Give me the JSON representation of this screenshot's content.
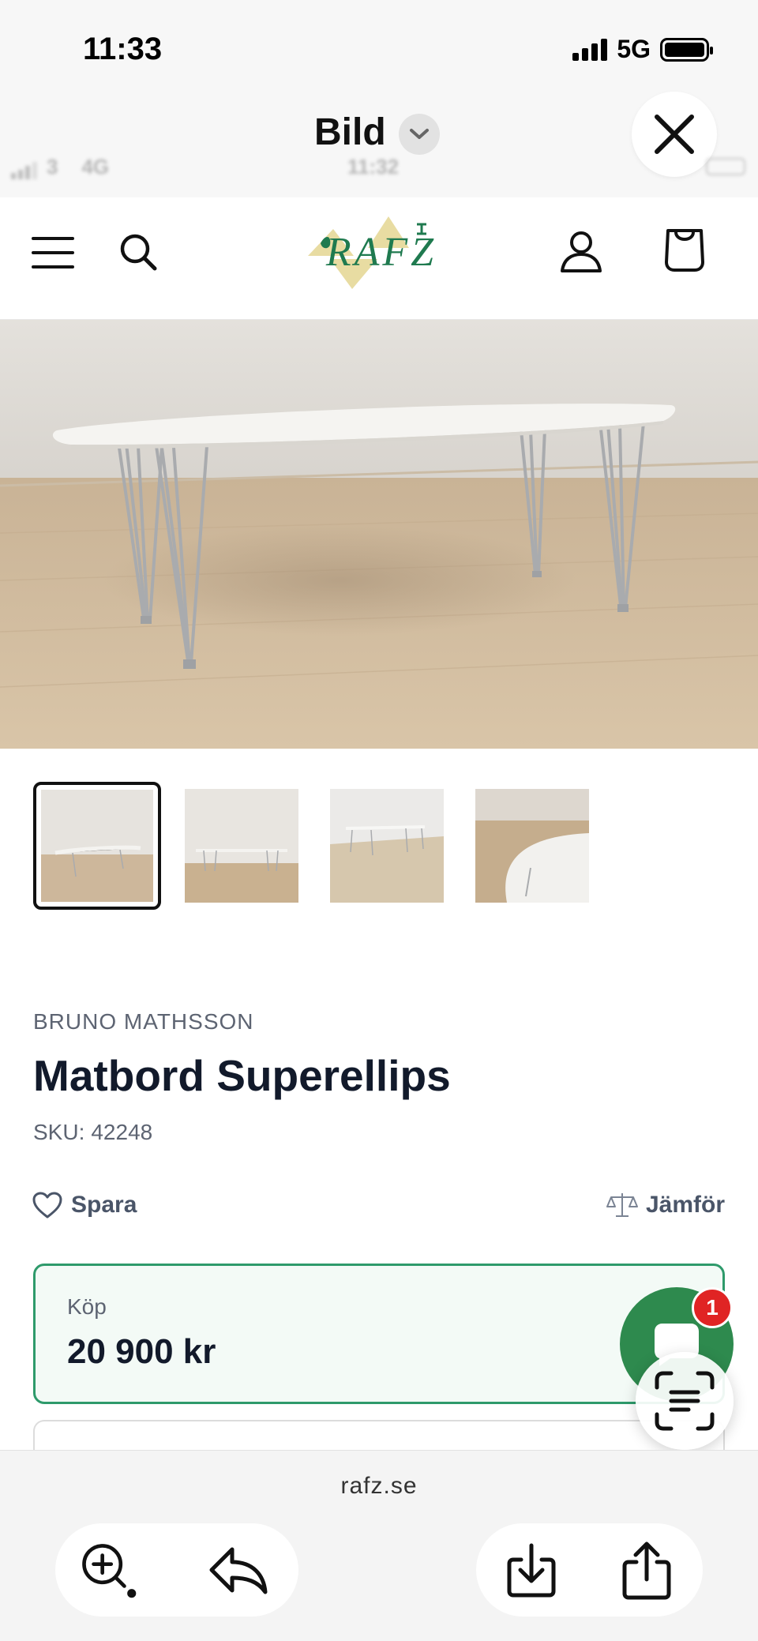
{
  "status_bar": {
    "time": "11:33",
    "network": "5G"
  },
  "viewer": {
    "title": "Bild"
  },
  "ghost_status": {
    "carrier": "3",
    "network": "4G",
    "time": "11:32"
  },
  "site": {
    "logo_text": "RAFZ"
  },
  "product": {
    "brand": "BRUNO MATHSSON",
    "title": "Matbord Superellips",
    "sku_label": "SKU:",
    "sku": "42248",
    "save_label": "Spara",
    "compare_label": "Jämför",
    "buy_label": "Köp",
    "price": "20 900 kr"
  },
  "chat": {
    "badge_count": "1"
  },
  "browser": {
    "url": "rafz.se"
  },
  "colors": {
    "accent_green": "#2e9a6b",
    "chat_green": "#2e8a4e",
    "badge_red": "#e02424",
    "logo_green": "#1f7a4f",
    "logo_sand": "#e8dca2"
  },
  "icons": [
    "close-icon",
    "chevron-down-icon",
    "menu-icon",
    "search-icon",
    "user-icon",
    "cart-icon",
    "heart-icon",
    "scale-icon",
    "chat-icon",
    "live-text-icon",
    "zoom-in-icon",
    "reply-icon",
    "download-icon",
    "share-icon"
  ]
}
